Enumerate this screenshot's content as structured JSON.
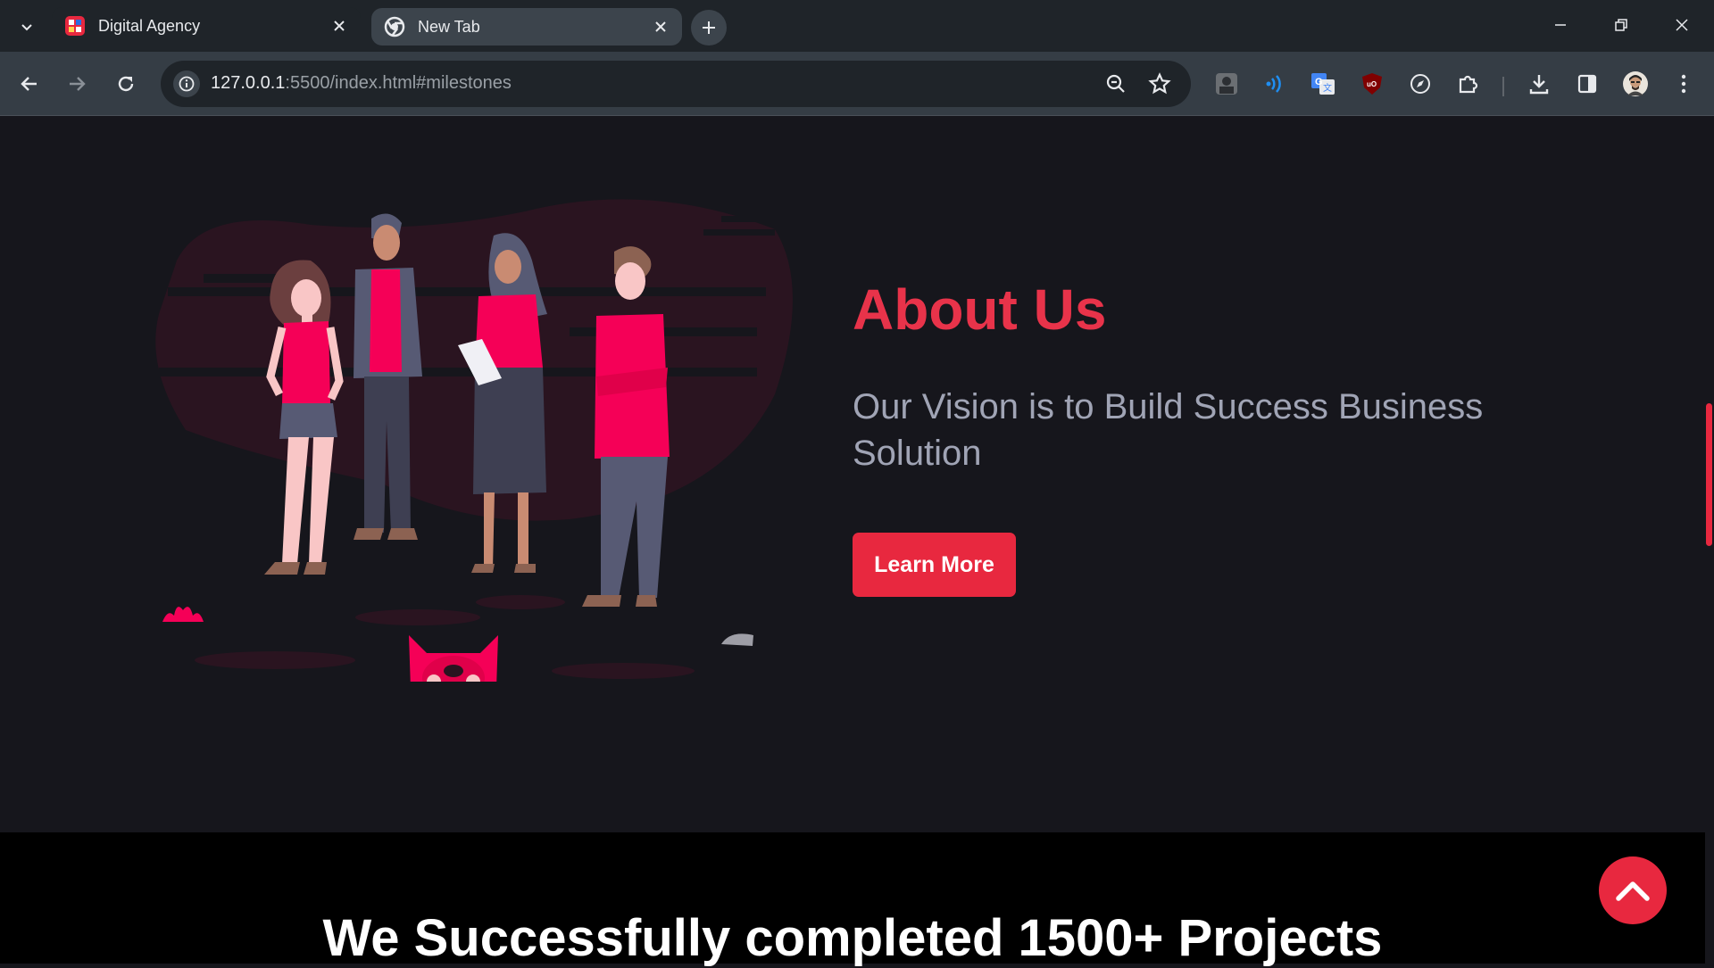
{
  "browser": {
    "tabs": [
      {
        "title": "Digital Agency",
        "active": true
      },
      {
        "title": "New Tab",
        "active": false
      }
    ],
    "url_host": "127.0.0.1",
    "url_rest": ":5500/index.html#milestones",
    "icons": {
      "tab_search": "chevron-down-icon",
      "back": "arrow-left-icon",
      "forward": "arrow-right-icon",
      "reload": "reload-icon",
      "zoom": "zoom-icon",
      "bookmark": "star-icon",
      "download": "download-icon",
      "side_panel": "side-panel-icon",
      "menu": "kebab-menu-icon"
    }
  },
  "about": {
    "title": "About Us",
    "subtitle": "Our Vision is to Build Success Business Solution",
    "button_label": "Learn More"
  },
  "stats": {
    "heading": "We Successfully completed 1500+ Projects"
  },
  "colors": {
    "accent": "#e8283f",
    "title": "#e8334a",
    "page_bg": "#16161c",
    "band_bg": "#000000",
    "subtitle": "#a0a4b5"
  }
}
